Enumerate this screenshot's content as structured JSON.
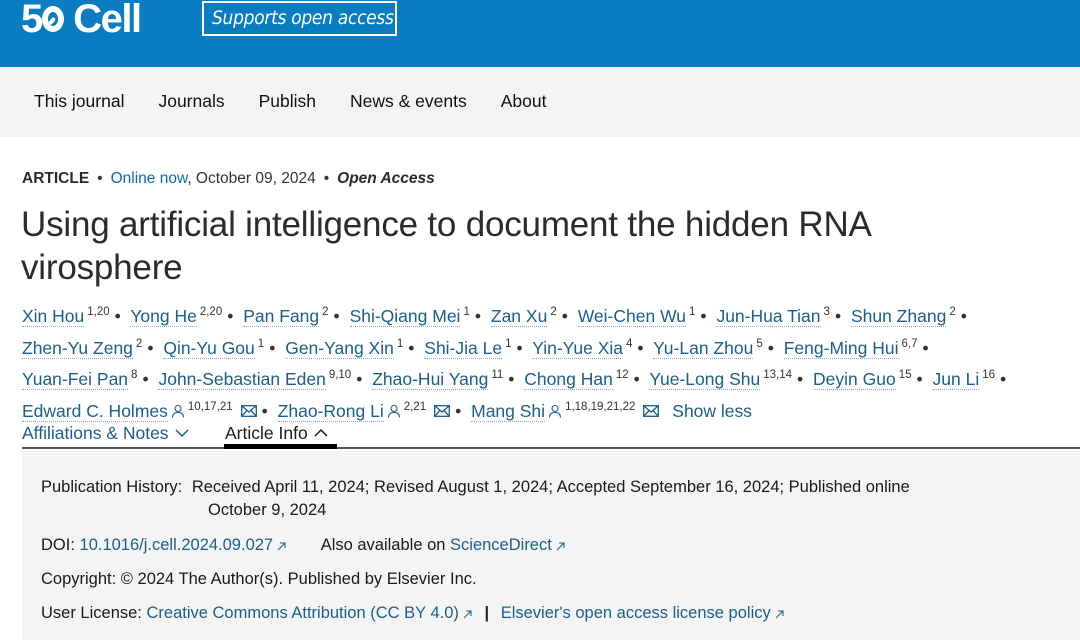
{
  "header": {
    "logo_number": "5",
    "logo_text": "Cell",
    "badge": "Supports open access",
    "brand_color": "#0a7cc1"
  },
  "nav": {
    "items": [
      "This journal",
      "Journals",
      "Publish",
      "News & events",
      "About"
    ]
  },
  "article": {
    "type": "ARTICLE",
    "online_label": "Online now",
    "date": ", October 09, 2024",
    "access": "Open Access",
    "title": "Using artificial intelligence to document the hidden RNA virosphere"
  },
  "authors": [
    {
      "name": "Xin Hou",
      "aff": "1,20"
    },
    {
      "name": "Yong He",
      "aff": "2,20"
    },
    {
      "name": "Pan Fang",
      "aff": "2"
    },
    {
      "name": "Shi-Qiang Mei",
      "aff": "1"
    },
    {
      "name": "Zan Xu",
      "aff": "2"
    },
    {
      "name": "Wei-Chen Wu",
      "aff": "1"
    },
    {
      "name": "Jun-Hua Tian",
      "aff": "3"
    },
    {
      "name": "Shun Zhang",
      "aff": "2"
    },
    {
      "name": "Zhen-Yu Zeng",
      "aff": "2"
    },
    {
      "name": "Qin-Yu Gou",
      "aff": "1"
    },
    {
      "name": "Gen-Yang Xin",
      "aff": "1"
    },
    {
      "name": "Shi-Jia Le",
      "aff": "1"
    },
    {
      "name": "Yin-Yue Xia",
      "aff": "4"
    },
    {
      "name": "Yu-Lan Zhou",
      "aff": "5"
    },
    {
      "name": "Feng-Ming Hui",
      "aff": "6,7"
    },
    {
      "name": "Yuan-Fei Pan",
      "aff": "8"
    },
    {
      "name": "John-Sebastian Eden",
      "aff": "9,10"
    },
    {
      "name": "Zhao-Hui Yang",
      "aff": "11"
    },
    {
      "name": "Chong Han",
      "aff": "12"
    },
    {
      "name": "Yue-Long Shu",
      "aff": "13,14"
    },
    {
      "name": "Deyin Guo",
      "aff": "15"
    },
    {
      "name": "Jun Li",
      "aff": "16"
    },
    {
      "name": "Edward C. Holmes",
      "aff": "10,17,21",
      "corresponding": true
    },
    {
      "name": "Zhao-Rong Li",
      "aff": "2,21",
      "corresponding": true
    },
    {
      "name": "Mang Shi",
      "aff": "1,18,19,21,22",
      "corresponding": true
    }
  ],
  "show_less": "Show less",
  "tabs": {
    "affiliations": "Affiliations & Notes",
    "article_info": "Article Info"
  },
  "info": {
    "pub_history_label": "Publication History:",
    "pub_history_line1": "Received April 11, 2024; Revised August 1, 2024; Accepted September 16, 2024; Published online",
    "pub_history_line2": "October 9, 2024",
    "doi_label": "DOI:",
    "doi_value": "10.1016/j.cell.2024.09.027",
    "also_label": "Also available on",
    "also_link": "ScienceDirect",
    "copyright": "Copyright: © 2024 The Author(s). Published by Elsevier Inc.",
    "license_label": "User License:",
    "license_link": "Creative Commons Attribution (CC BY 4.0)",
    "policy_link": "Elsevier's open access license policy"
  }
}
